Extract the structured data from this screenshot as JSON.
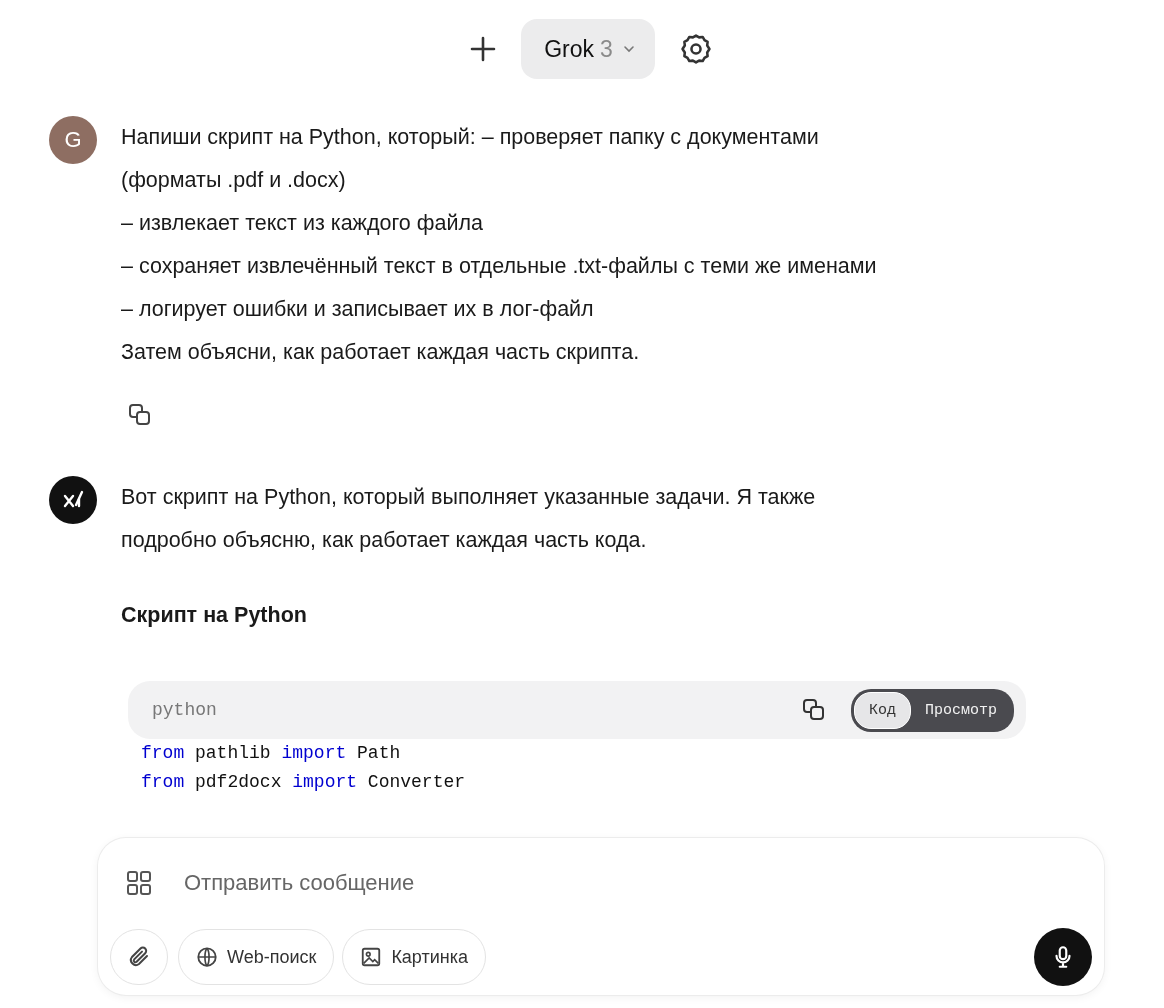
{
  "header": {
    "model_name": "Grok",
    "model_version": "3"
  },
  "messages": [
    {
      "kind": "user",
      "avatar_letter": "G",
      "lines": [
        "Напиши скрипт на Python, который: – проверяет папку с документами",
        "(форматы .pdf и .docx)",
        "– извлекает текст из каждого файла",
        "– сохраняет извлечённый текст в отдельные .txt-файлы с теми же именами",
        "– логирует ошибки и записывает их в лог-файл",
        "Затем объясни, как работает каждая часть скрипта."
      ]
    },
    {
      "kind": "assistant",
      "lines": [
        "Вот скрипт на Python, который выполняет указанные задачи. Я также",
        "подробно объясню, как работает каждая часть кода."
      ],
      "heading": "Скрипт на Python",
      "code_block": {
        "language": "python",
        "tabs": [
          {
            "label": "Код",
            "selected": true
          },
          {
            "label": "Просмотр",
            "selected": false
          }
        ],
        "lines": [
          [
            {
              "kind": "keyword",
              "text": "from"
            },
            {
              "kind": "plain",
              "text": " pathlib "
            },
            {
              "kind": "keyword",
              "text": "import"
            },
            {
              "kind": "plain",
              "text": " Path"
            }
          ],
          [
            {
              "kind": "keyword",
              "text": "from"
            },
            {
              "kind": "plain",
              "text": " pdf2docx "
            },
            {
              "kind": "keyword",
              "text": "import"
            },
            {
              "kind": "plain",
              "text": " Converter"
            }
          ]
        ]
      }
    }
  ],
  "composer": {
    "placeholder": "Отправить сообщение",
    "buttons": [
      "Web-поиск",
      "Картинка"
    ]
  }
}
